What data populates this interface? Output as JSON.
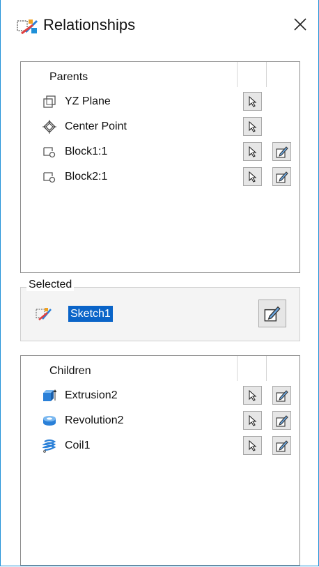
{
  "window": {
    "title": "Relationships",
    "icon": "relationships-sketch-icon",
    "close_icon": "close-icon"
  },
  "parents": {
    "header": "Parents",
    "items": [
      {
        "label": "YZ Plane",
        "icon": "plane-icon",
        "select_button": true,
        "edit_button": false
      },
      {
        "label": "Center Point",
        "icon": "point-icon",
        "select_button": true,
        "edit_button": false
      },
      {
        "label": "Block1:1",
        "icon": "block-icon",
        "select_button": true,
        "edit_button": true
      },
      {
        "label": "Block2:1",
        "icon": "block-icon",
        "select_button": true,
        "edit_button": true
      }
    ]
  },
  "selected": {
    "legend": "Selected",
    "name": "Sketch1",
    "icon": "sketch-icon",
    "edit_icon": "edit-icon"
  },
  "children": {
    "header": "Children",
    "items": [
      {
        "label": "Extrusion2",
        "icon": "extrusion-icon",
        "select_button": true,
        "edit_button": true
      },
      {
        "label": "Revolution2",
        "icon": "revolution-icon",
        "select_button": true,
        "edit_button": true
      },
      {
        "label": "Coil1",
        "icon": "coil-icon",
        "select_button": true,
        "edit_button": true
      }
    ]
  },
  "colors": {
    "accent": "#0a64c8",
    "window_border": "#1e90d8",
    "button_face": "#e6e6e6"
  }
}
